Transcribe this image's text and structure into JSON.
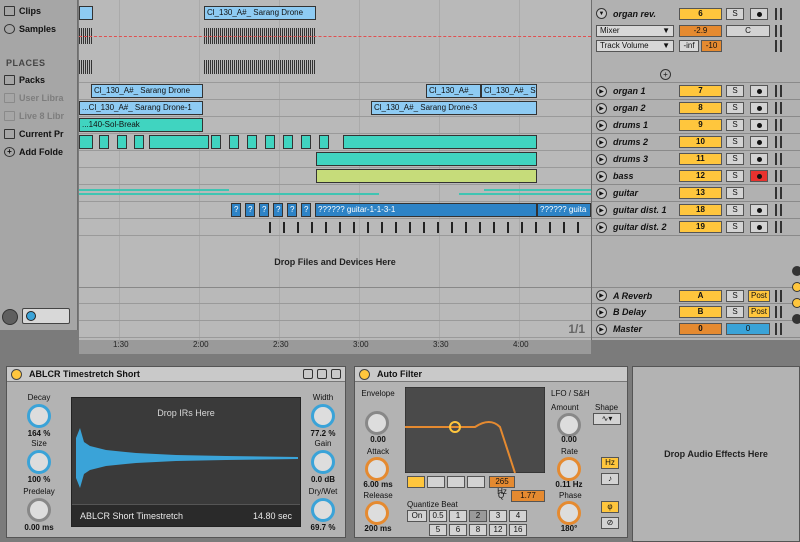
{
  "browser": {
    "items": [
      "Clips",
      "Samples"
    ],
    "places_header": "PLACES",
    "places": [
      {
        "label": "Packs",
        "dim": false
      },
      {
        "label": "User Libra",
        "dim": true
      },
      {
        "label": "Live 8 Libr",
        "dim": true
      },
      {
        "label": "Current Pr",
        "dim": false
      },
      {
        "label": "Add Folde",
        "dim": false
      }
    ]
  },
  "arrangement": {
    "clips": {
      "organ_rev_1": "Cl_130_A#_ Sarang Drone",
      "organ1_a": "Cl_130_A#_ Sarang Drone",
      "organ1_b": "Cl_130_A#_",
      "organ1_c": "Cl_130_A#_ S",
      "organ2_a": "...Cl_130_A#_ Sarang Drone-1",
      "organ2_b": "Cl_130_A#_ Sarang Drone-3",
      "drums1_a": "...140-Sol-Break",
      "guitar_dist": "?????? guitar-1-1-3-1",
      "guitar_dist_b": "?????? guita",
      "qmark": "?"
    },
    "drop_label": "Drop Files and Devices Here",
    "zoom_ratio": "1/1",
    "timeline": [
      "1:30",
      "2:00",
      "2:30",
      "3:00",
      "3:30",
      "4:00"
    ]
  },
  "mixer": {
    "organ_rev": {
      "name": "organ rev.",
      "number": "6",
      "solo": "S",
      "mixer_select": "Mixer",
      "param_select": "Track Volume",
      "volume": "-2.9",
      "send_c": "C",
      "inf": "-inf",
      "ten": "-10"
    },
    "tracks": [
      {
        "name": "organ 1",
        "number": "7",
        "solo": "S",
        "arm_red": false
      },
      {
        "name": "organ 2",
        "number": "8",
        "solo": "S",
        "arm_red": false
      },
      {
        "name": "drums 1",
        "number": "9",
        "solo": "S",
        "arm_red": false
      },
      {
        "name": "drums 2",
        "number": "10",
        "solo": "S",
        "arm_red": false
      },
      {
        "name": "drums 3",
        "number": "11",
        "solo": "S",
        "arm_red": false
      },
      {
        "name": "bass",
        "number": "12",
        "solo": "S",
        "arm_red": true
      },
      {
        "name": "guitar",
        "number": "13",
        "solo": "S",
        "arm_red": false
      },
      {
        "name": "guitar dist. 1",
        "number": "18",
        "solo": "S",
        "arm_red": false
      },
      {
        "name": "guitar dist. 2",
        "number": "19",
        "solo": "S",
        "arm_red": false
      }
    ],
    "returns": [
      {
        "name": "A Reverb",
        "number": "A",
        "solo": "S",
        "post": "Post"
      },
      {
        "name": "B Delay",
        "number": "B",
        "solo": "S",
        "post": "Post"
      }
    ],
    "master": {
      "name": "Master",
      "left": "0",
      "right": "0"
    }
  },
  "reverb": {
    "title": "ABLCR Timestretch Short",
    "decay_label": "Decay",
    "decay_value": "164 %",
    "size_label": "Size",
    "size_value": "100 %",
    "predelay_label": "Predelay",
    "predelay_value": "0.00 ms",
    "drop_irs": "Drop IRs Here",
    "ir_name": "ABLCR Short Timestretch",
    "ir_time": "14.80 sec",
    "width_label": "Width",
    "width_value": "77.2 %",
    "gain_label": "Gain",
    "gain_value": "0.0 dB",
    "drywet_label": "Dry/Wet",
    "drywet_value": "69.7 %"
  },
  "autofilter": {
    "title": "Auto Filter",
    "envelope_label": "Envelope",
    "envelope_value": "0.00",
    "attack_label": "Attack",
    "attack_value": "6.00 ms",
    "release_label": "Release",
    "release_value": "200 ms",
    "freq": "265 Hz",
    "q_label": "Q",
    "q_value": "1.77",
    "quantize_label": "Quantize Beat",
    "quantize": [
      "On",
      "0.5",
      "1",
      "2",
      "3",
      "4",
      "5",
      "6",
      "8",
      "12",
      "16"
    ],
    "lfo_label": "LFO / S&H",
    "amount_label": "Amount",
    "amount_value": "0.00",
    "shape_label": "Shape",
    "rate_label": "Rate",
    "rate_value": "0.11 Hz",
    "hz_btn": "Hz",
    "phase_label": "Phase",
    "phase_value": "180°"
  },
  "drop_effects": "Drop Audio Effects Here",
  "colors": {
    "clip_blue": "#8ecbf3",
    "clip_teal": "#40d4c0",
    "clip_olive": "#c6dc7a",
    "track_number_yellow": "#ffc63d",
    "arm_red": "#e8322e",
    "knob_blue": "#3aa3d8",
    "knob_orange": "#e58a30"
  }
}
